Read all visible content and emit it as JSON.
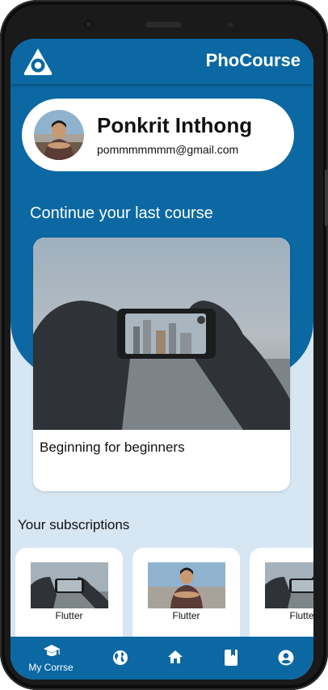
{
  "app": {
    "brand": "PhoCourse"
  },
  "profile": {
    "name": "Ponkrit Inthong",
    "email": "pommmmmmm@gmail.com"
  },
  "continue": {
    "heading": "Continue your last course",
    "course_title": "Beginning for beginners"
  },
  "subscriptions": {
    "heading": "Your subscriptions",
    "items": [
      {
        "label": "Flutter",
        "thumb": "phone-photo"
      },
      {
        "label": "Flutter",
        "thumb": "person-photo"
      },
      {
        "label": "Flutter",
        "thumb": "phone-photo"
      }
    ]
  },
  "nav": {
    "items": [
      {
        "label": "My Corrse",
        "icon": "graduation-cap-icon",
        "active": true
      },
      {
        "label": "",
        "icon": "globe-icon"
      },
      {
        "label": "",
        "icon": "home-icon"
      },
      {
        "label": "",
        "icon": "book-icon"
      },
      {
        "label": "",
        "icon": "account-icon"
      }
    ]
  },
  "colors": {
    "primary": "#0b68a3",
    "background": "#d6e6f3",
    "card": "#ffffff"
  }
}
